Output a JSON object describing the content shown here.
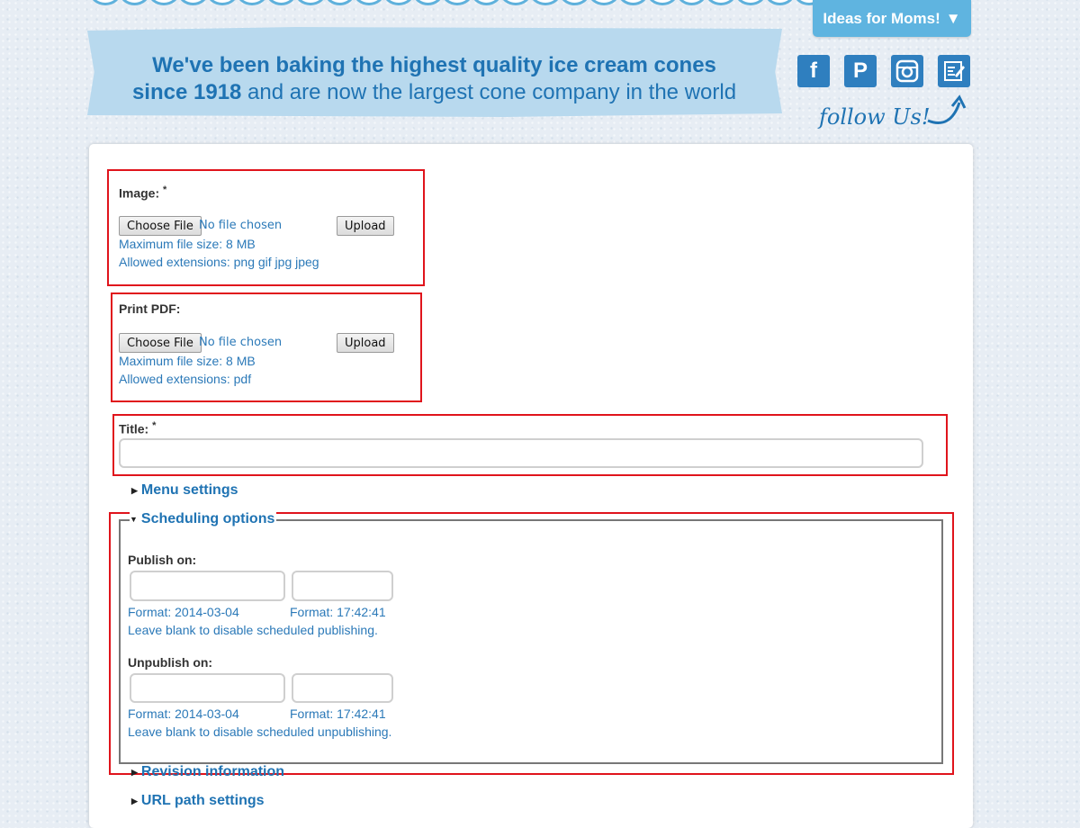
{
  "header": {
    "ideas_tab_label": "Ideas for Moms!",
    "ideas_tab_arrow": "▼",
    "banner_line1": "We've been baking the highest quality ice cream cones",
    "banner_line2_bold": "since 1918",
    "banner_line2_rest": " and are now the largest cone company in the world",
    "follow_us": "follow Us!",
    "social": [
      {
        "name": "facebook-icon",
        "glyph": "f"
      },
      {
        "name": "pinterest-icon",
        "glyph": "P"
      },
      {
        "name": "instagram-icon",
        "glyph": "◙"
      },
      {
        "name": "blog-icon",
        "glyph": "✎"
      }
    ]
  },
  "form": {
    "image": {
      "label": "Image:",
      "required_mark": "*",
      "choose_label": "Choose File",
      "no_file": "No file chosen",
      "upload_label": "Upload",
      "max_size": "Maximum file size: 8 MB",
      "extensions": "Allowed extensions: png gif jpg jpeg"
    },
    "pdf": {
      "label": "Print PDF:",
      "choose_label": "Choose File",
      "no_file": "No file chosen",
      "upload_label": "Upload",
      "max_size": "Maximum file size: 8 MB",
      "extensions": "Allowed extensions: pdf"
    },
    "title": {
      "label": "Title:",
      "required_mark": "*",
      "value": ""
    },
    "menu_settings": "Menu settings",
    "scheduling": {
      "legend": "Scheduling options",
      "publish_label": "Publish on:",
      "publish_date_format": "Format: 2014-03-04",
      "publish_time_format": "Format: 17:42:41",
      "publish_help": "Leave blank to disable scheduled publishing.",
      "unpublish_label": "Unpublish on:",
      "unpublish_date_format": "Format: 2014-03-04",
      "unpublish_time_format": "Format: 17:42:41",
      "unpublish_help": "Leave blank to disable scheduled unpublishing."
    },
    "revision_information": "Revision information",
    "url_path_settings": "URL path settings"
  },
  "colors": {
    "accent_blue": "#1f73b3",
    "tab_blue": "#5fb4e0",
    "highlight_red": "#e0141c"
  }
}
